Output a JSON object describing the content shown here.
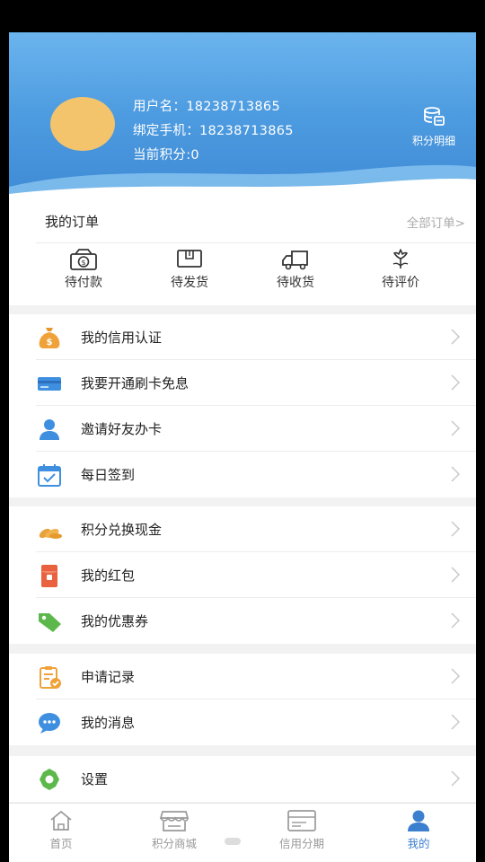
{
  "profile": {
    "username_line": "用户名：18238713865",
    "phone_line": "绑定手机：18238713865",
    "points_line": "当前积分:0",
    "points_detail_label": "积分明细"
  },
  "orders": {
    "title": "我的订单",
    "all_link": "全部订单>",
    "items": [
      {
        "label": "待付款",
        "icon": "payment-icon"
      },
      {
        "label": "待发货",
        "icon": "shipping-box-icon"
      },
      {
        "label": "待收货",
        "icon": "truck-icon"
      },
      {
        "label": "待评价",
        "icon": "flower-review-icon"
      }
    ]
  },
  "menu": {
    "group1": [
      {
        "label": "我的信用认证",
        "icon": "money-bag-icon"
      },
      {
        "label": "我要开通刷卡免息",
        "icon": "credit-card-icon"
      },
      {
        "label": "邀请好友办卡",
        "icon": "person-icon"
      },
      {
        "label": "每日签到",
        "icon": "calendar-check-icon"
      }
    ],
    "group2": [
      {
        "label": "积分兑换现金",
        "icon": "coins-icon"
      },
      {
        "label": "我的红包",
        "icon": "red-envelope-icon"
      },
      {
        "label": "我的优惠券",
        "icon": "tag-icon"
      }
    ],
    "group3": [
      {
        "label": "申请记录",
        "icon": "clipboard-icon"
      },
      {
        "label": "我的消息",
        "icon": "chat-bubble-icon"
      }
    ],
    "group4": [
      {
        "label": "设置",
        "icon": "gear-icon"
      }
    ]
  },
  "tabbar": {
    "items": [
      {
        "label": "首页",
        "icon": "home-icon"
      },
      {
        "label": "积分商城",
        "icon": "store-icon"
      },
      {
        "label": "信用分期",
        "icon": "card-installment-icon"
      },
      {
        "label": "我的",
        "icon": "user-icon"
      }
    ],
    "active": "我的"
  },
  "colors": {
    "header_top": "#6bb4ee",
    "header_bottom": "#3f8bd6",
    "avatar": "#f4c46c",
    "active_tab": "#3d7fcf"
  }
}
